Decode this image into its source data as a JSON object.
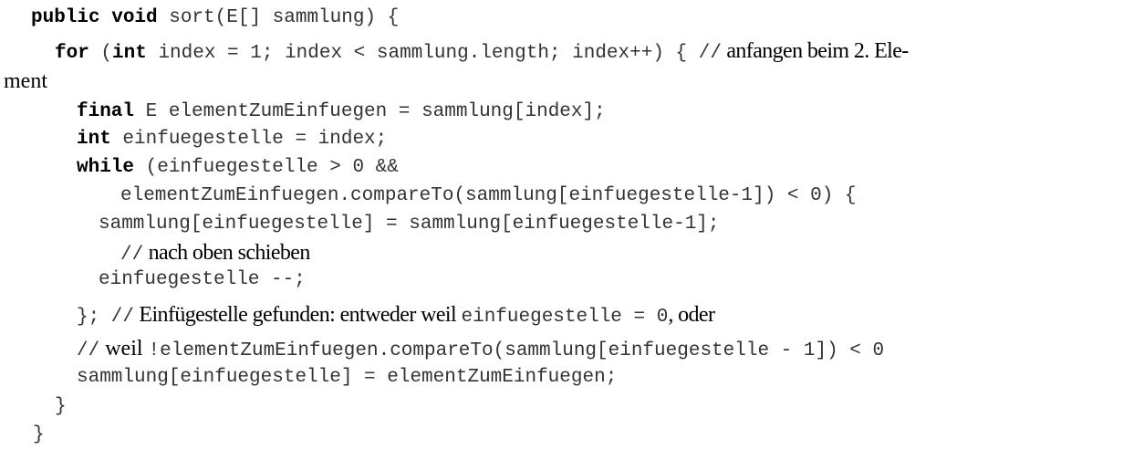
{
  "code": {
    "l1": {
      "kw1": "public void",
      "t1": " sort(E[] sammlung) {"
    },
    "l2": {
      "kw1": "for",
      "t1": " (",
      "kw2": "int",
      "t2": " index = 1; index < sammlung.length; index++) { //",
      "c1": " anfangen beim 2. Ele-"
    },
    "l3": {
      "c1": "ment"
    },
    "l4": {
      "kw1": "final",
      "t1": " E elementZumEinfuegen = sammlung[index];"
    },
    "l5": {
      "kw1": "int",
      "t1": " einfuegestelle = index;"
    },
    "l6": {
      "kw1": "while",
      "t1": " (einfuegestelle > 0 &&"
    },
    "l7": {
      "t1": "elementZumEinfuegen.compareTo(sammlung[einfuegestelle-1]) < 0) {"
    },
    "l8": {
      "t1": "sammlung[einfuegestelle] = sammlung[einfuegestelle-1];"
    },
    "l9": {
      "t1": "//",
      "c1": " nach oben schieben"
    },
    "l10": {
      "t1": "einfuegestelle --;"
    },
    "l11": {
      "t1": "}; //",
      "c1": " Einfügestelle gefunden: entweder weil ",
      "t2": "einfuegestelle = 0",
      "c2": ", oder"
    },
    "l12": {
      "t1": "//",
      "c1": " weil ",
      "t2": "!elementZumEinfuegen.compareTo(sammlung[einfuegestelle - 1]) < 0"
    },
    "l13": {
      "t1": "sammlung[einfuegestelle] = elementZumEinfuegen;"
    },
    "l14": {
      "t1": "}"
    },
    "l15": {
      "t1": "}"
    }
  }
}
